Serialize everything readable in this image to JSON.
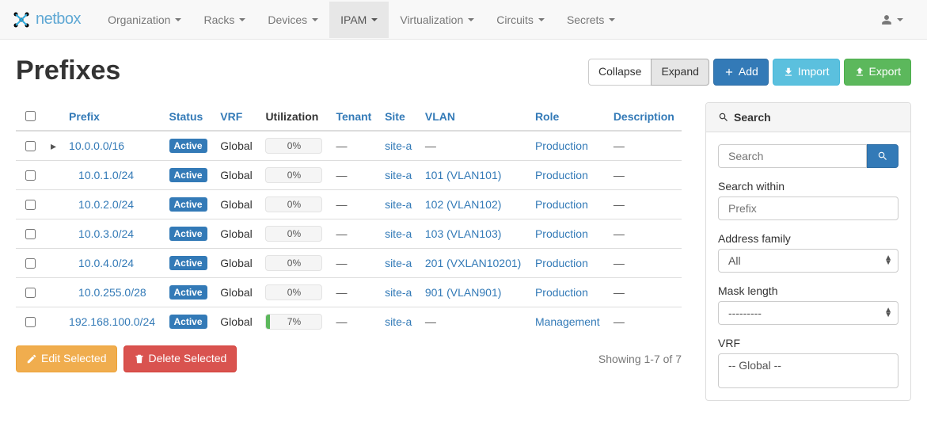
{
  "brand": "netbox",
  "nav": [
    {
      "label": "Organization",
      "active": false
    },
    {
      "label": "Racks",
      "active": false
    },
    {
      "label": "Devices",
      "active": false
    },
    {
      "label": "IPAM",
      "active": true
    },
    {
      "label": "Virtualization",
      "active": false
    },
    {
      "label": "Circuits",
      "active": false
    },
    {
      "label": "Secrets",
      "active": false
    }
  ],
  "page_title": "Prefixes",
  "top_buttons": {
    "collapse": "Collapse",
    "expand": "Expand",
    "add": "Add",
    "import": "Import",
    "export": "Export"
  },
  "columns": {
    "prefix": "Prefix",
    "status": "Status",
    "vrf": "VRF",
    "utilization": "Utilization",
    "tenant": "Tenant",
    "site": "Site",
    "vlan": "VLAN",
    "role": "Role",
    "description": "Description"
  },
  "rows": [
    {
      "indent": 0,
      "expander": true,
      "prefix": "10.0.0.0/16",
      "status": "Active",
      "vrf": "Global",
      "util_pct": 0,
      "util_label": "0%",
      "tenant": "—",
      "site": "site-a",
      "vlan": "—",
      "role": "Production",
      "description": "—"
    },
    {
      "indent": 1,
      "expander": false,
      "prefix": "10.0.1.0/24",
      "status": "Active",
      "vrf": "Global",
      "util_pct": 0,
      "util_label": "0%",
      "tenant": "—",
      "site": "site-a",
      "vlan": "101 (VLAN101)",
      "role": "Production",
      "description": "—"
    },
    {
      "indent": 1,
      "expander": false,
      "prefix": "10.0.2.0/24",
      "status": "Active",
      "vrf": "Global",
      "util_pct": 0,
      "util_label": "0%",
      "tenant": "—",
      "site": "site-a",
      "vlan": "102 (VLAN102)",
      "role": "Production",
      "description": "—"
    },
    {
      "indent": 1,
      "expander": false,
      "prefix": "10.0.3.0/24",
      "status": "Active",
      "vrf": "Global",
      "util_pct": 0,
      "util_label": "0%",
      "tenant": "—",
      "site": "site-a",
      "vlan": "103 (VLAN103)",
      "role": "Production",
      "description": "—"
    },
    {
      "indent": 1,
      "expander": false,
      "prefix": "10.0.4.0/24",
      "status": "Active",
      "vrf": "Global",
      "util_pct": 0,
      "util_label": "0%",
      "tenant": "—",
      "site": "site-a",
      "vlan": "201 (VXLAN10201)",
      "role": "Production",
      "description": "—"
    },
    {
      "indent": 1,
      "expander": false,
      "prefix": "10.0.255.0/28",
      "status": "Active",
      "vrf": "Global",
      "util_pct": 0,
      "util_label": "0%",
      "tenant": "—",
      "site": "site-a",
      "vlan": "901 (VLAN901)",
      "role": "Production",
      "description": "—"
    },
    {
      "indent": 0,
      "expander": false,
      "prefix": "192.168.100.0/24",
      "status": "Active",
      "vrf": "Global",
      "util_pct": 7,
      "util_label": "7%",
      "tenant": "—",
      "site": "site-a",
      "vlan": "—",
      "role": "Management",
      "description": "—"
    }
  ],
  "showing": "Showing 1-7 of 7",
  "actions": {
    "edit_selected": "Edit Selected",
    "delete_selected": "Delete Selected"
  },
  "search_panel": {
    "heading": "Search",
    "search_placeholder": "Search",
    "search_within_label": "Search within",
    "search_within_placeholder": "Prefix",
    "address_family_label": "Address family",
    "address_family_value": "All",
    "mask_length_label": "Mask length",
    "mask_length_value": "---------",
    "vrf_label": "VRF",
    "vrf_option": "-- Global --"
  }
}
